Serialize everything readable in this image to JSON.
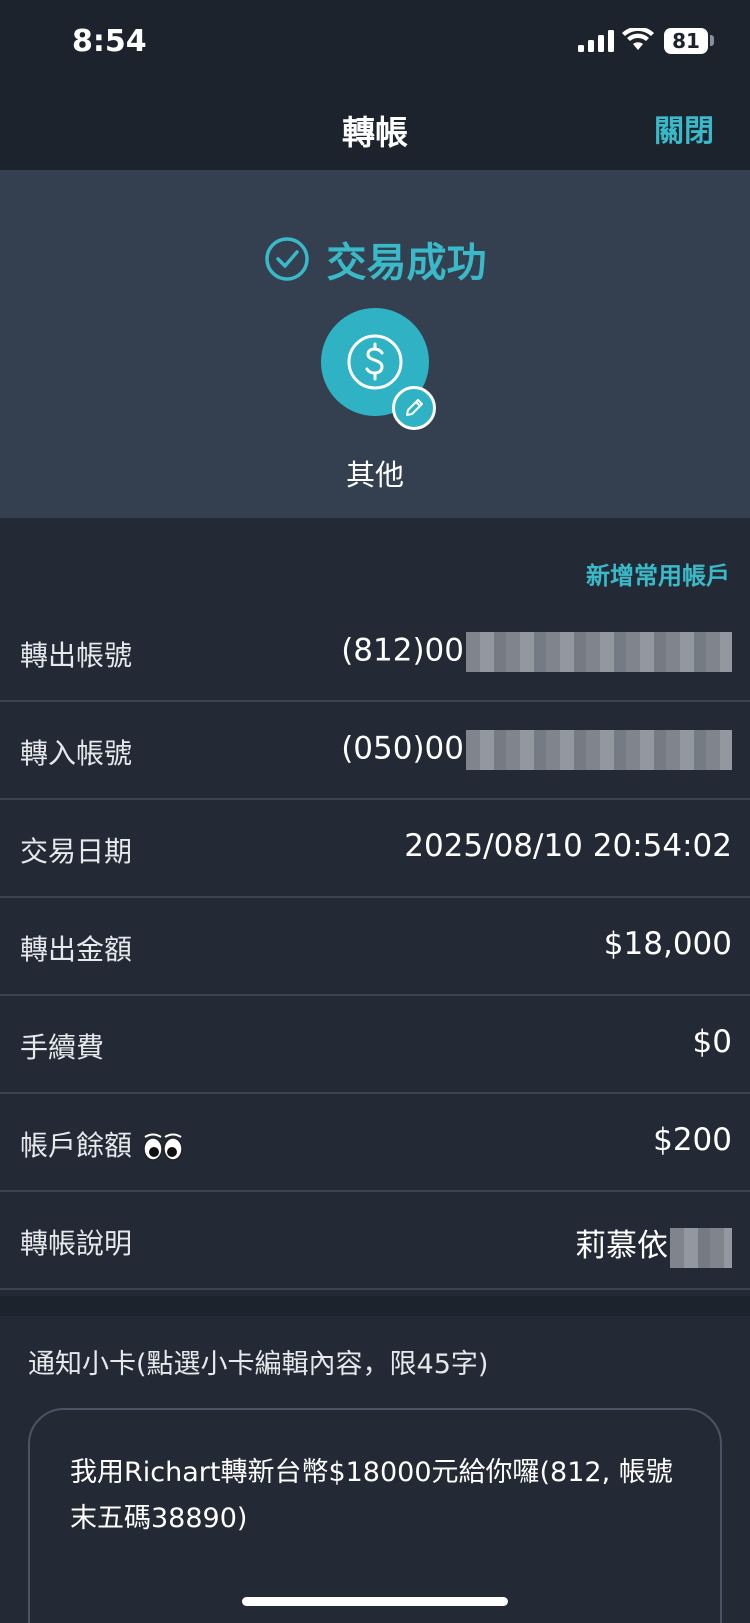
{
  "status_bar": {
    "time": "8:54",
    "battery": "81"
  },
  "nav": {
    "title": "轉帳",
    "close_label": "關閉"
  },
  "hero": {
    "success_text": "交易成功",
    "category_label": "其他",
    "accent_color": "#2fb3c4"
  },
  "add_favorite_label": "新增常用帳戶",
  "details": [
    {
      "label": "轉出帳號",
      "value": "(812)00"
    },
    {
      "label": "轉入帳號",
      "value": "(050)00"
    },
    {
      "label": "交易日期",
      "value": "2025/08/10 20:54:02"
    },
    {
      "label": "轉出金額",
      "value": "$18,000"
    },
    {
      "label": "手續費",
      "value": "$0"
    },
    {
      "label": "帳戶餘額",
      "value": "$200"
    },
    {
      "label": "轉帳說明",
      "value": "莉慕依"
    }
  ],
  "notification_card": {
    "title": "通知小卡(點選小卡編輯內容，限45字)",
    "text": "我用Richart轉新台幣$18000元給你囉(812, 帳號末五碼38890)"
  }
}
